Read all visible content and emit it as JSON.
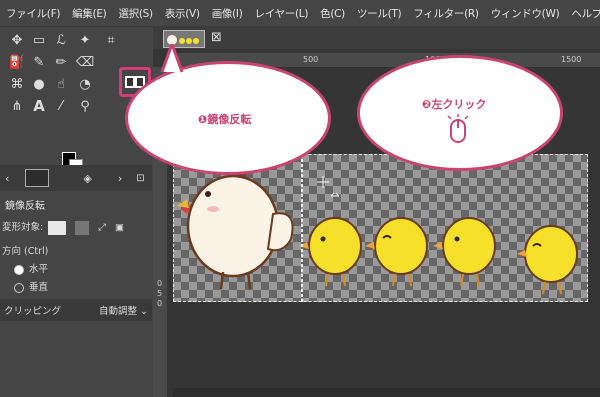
{
  "menu": [
    "ファイル(F)",
    "編集(E)",
    "選択(S)",
    "表示(V)",
    "画像(I)",
    "レイヤー(L)",
    "色(C)",
    "ツール(T)",
    "フィルター(R)",
    "ウィンドウ(W)",
    "ヘルプ(H)"
  ],
  "tool_options": {
    "title": "鏡像反転",
    "transform_label": "変形対象:",
    "direction_label": "方向 (Ctrl)",
    "horizontal": "水平",
    "vertical": "垂直",
    "clipping_label": "クリッピング",
    "clipping_value": "自動調整"
  },
  "canvas": {
    "ruler_marks": [
      "500",
      "1000",
      "1500"
    ],
    "ruler_v_marks": [
      "0",
      "5",
      "0"
    ]
  },
  "callouts": {
    "first": "❶鏡像反転",
    "second": "❷左クリック"
  },
  "colors": {
    "accent": "#d63b7a",
    "chick_yellow": "#f7e02a",
    "hen_white": "#fbf3e6"
  }
}
